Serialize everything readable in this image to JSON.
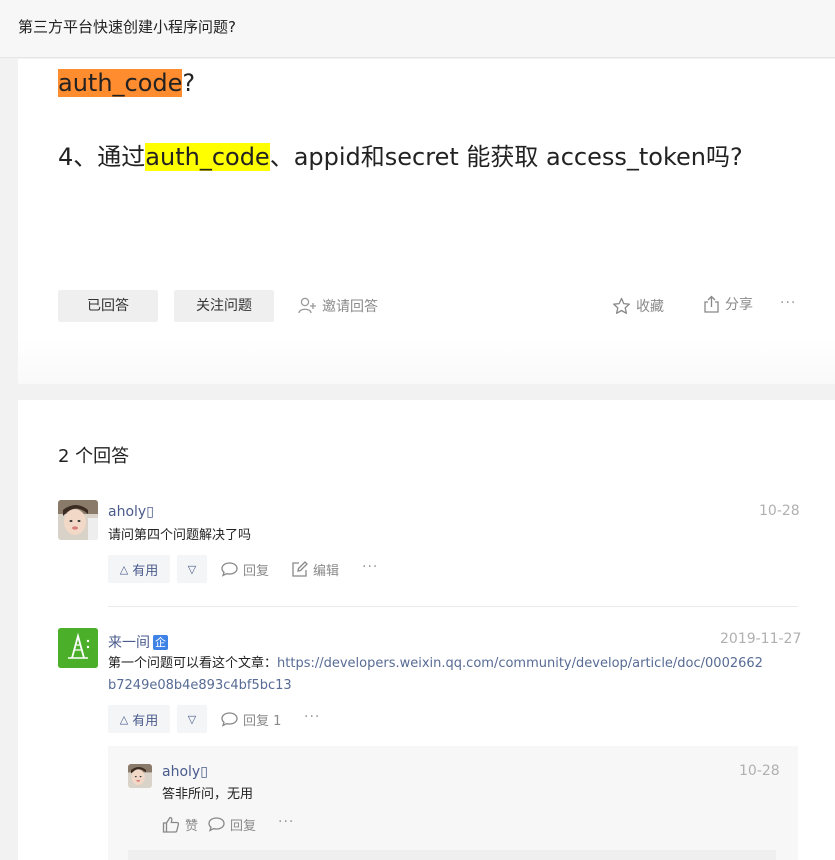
{
  "header": {
    "title": "第三方平台快速创建小程序问题?"
  },
  "question": {
    "line1_highlight": "auth_code",
    "line1_rest": "?",
    "line2_prefix": "4、通过",
    "line2_highlight": "auth_code",
    "line2_rest": "、appid和secret 能获取 access_token吗?",
    "highlight_colors": {
      "orange": "#ff8c2e",
      "yellow": "#ffff00"
    },
    "actions": {
      "answered": "已回答",
      "follow": "关注问题",
      "invite": "邀请回答",
      "collect": "收藏",
      "share": "分享",
      "more": "···"
    }
  },
  "answers": {
    "count_label": "2 个回答",
    "items": [
      {
        "user": "aholy▯",
        "date": "10-28",
        "text": "请问第四个问题解决了吗",
        "useful": "有用",
        "reply": "回复",
        "edit": "编辑",
        "more": "···",
        "avatar_icon": "user-photo"
      },
      {
        "user": "来一间",
        "badge": "企",
        "date": "2019-11-27",
        "text_prefix": "第一个问题可以看这个文章：",
        "link_line1": "https://developers.weixin.qq.com/community/develop/article/doc/0002662",
        "link_line2": "b7249e08b4e893c4bf5bc13",
        "useful": "有用",
        "reply": "回复 1",
        "more": "···",
        "avatar_icon": "green-logo",
        "avatar_color": "#4caf2a",
        "replies": [
          {
            "user": "aholy▯",
            "date": "10-28",
            "text": "答非所问，无用",
            "like": "赞",
            "reply": "回复",
            "more": "···"
          }
        ]
      }
    ]
  },
  "colors": {
    "username": "#4a5b8c",
    "link": "#576b95",
    "badge": "#3f82e6"
  }
}
